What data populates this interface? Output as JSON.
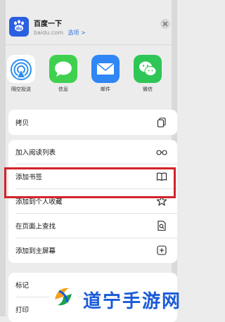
{
  "header": {
    "app_name": "百度一下",
    "domain": "baidu.com",
    "options_label": "选项 >"
  },
  "share": [
    {
      "label": "隔空投送",
      "icon": "airdrop-icon"
    },
    {
      "label": "信息",
      "icon": "messages-icon"
    },
    {
      "label": "邮件",
      "icon": "mail-icon"
    },
    {
      "label": "微信",
      "icon": "wechat-icon"
    }
  ],
  "actions": {
    "copy": "拷贝",
    "reading_list": "加入阅读列表",
    "bookmark": "添加书签",
    "favorites": "添加到个人收藏",
    "find": "在页面上查找",
    "home_screen": "添加到主屏幕",
    "markup": "标记",
    "print": "打印"
  },
  "watermark": {
    "text": "道宁手游网"
  },
  "colors": {
    "highlight": "#d2232a",
    "link": "#2f6fe0",
    "baidu_blue": "#2a5fe0"
  }
}
